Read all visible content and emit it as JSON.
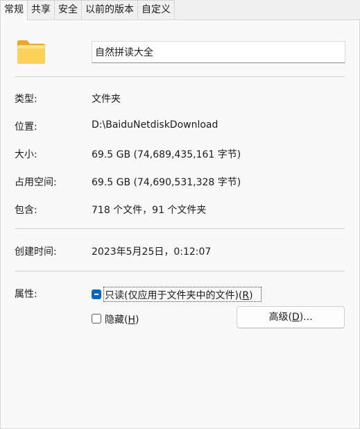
{
  "tabs": [
    "常规",
    "共享",
    "安全",
    "以前的版本",
    "自定义"
  ],
  "active_tab": "常规",
  "folder_name": "自然拼读大全",
  "properties": {
    "type_label": "类型:",
    "type_value": "文件夹",
    "location_label": "位置:",
    "location_value": "D:\\BaiduNetdiskDownload",
    "size_label": "大小:",
    "size_value": "69.5 GB (74,689,435,161 字节)",
    "size_on_disk_label": "占用空间:",
    "size_on_disk_value": "69.5 GB (74,690,531,328 字节)",
    "contains_label": "包含:",
    "contains_value": "718 个文件，91 个文件夹",
    "created_label": "创建时间:",
    "created_value": "2023年5月25日，0:12:07"
  },
  "attributes": {
    "label": "属性:",
    "readonly": {
      "text": "只读(仅应用于文件夹中的文件)(",
      "access_key": "R",
      "suffix": ")",
      "state": "indeterminate"
    },
    "hidden": {
      "text": "隐藏(",
      "access_key": "H",
      "suffix": ")",
      "state": "unchecked"
    },
    "advanced_button": {
      "text": "高级(",
      "access_key": "D",
      "suffix": ")..."
    }
  },
  "colors": {
    "accent": "#0067c0",
    "panel_bg": "#f9f9f9",
    "tab_bg": "#f0f0f0",
    "folder_yellow": "#f8c840"
  },
  "icons": {
    "folder": "folder-icon"
  }
}
